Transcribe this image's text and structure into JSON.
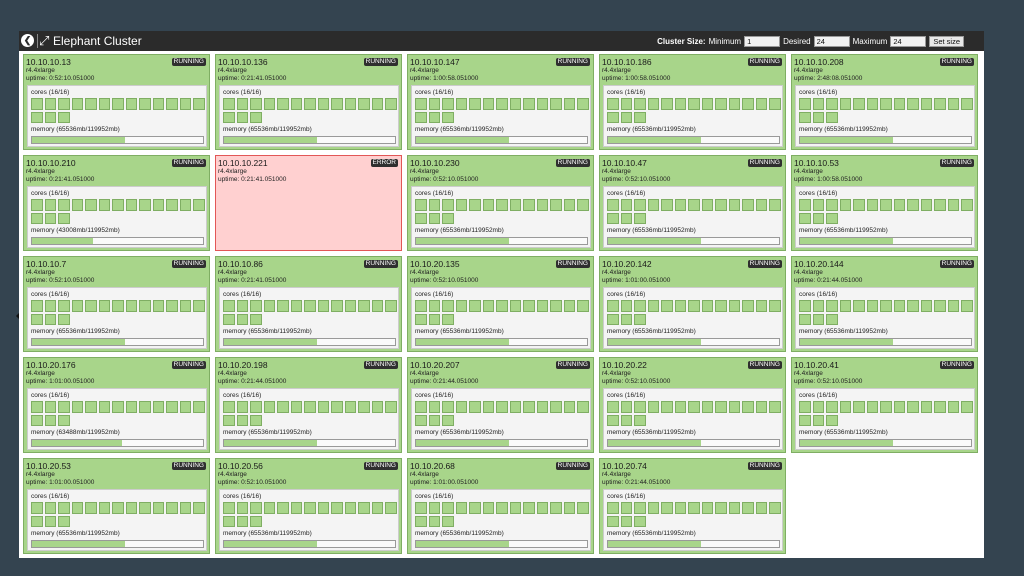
{
  "header": {
    "back_icon": "back-arrow-circle-icon",
    "expand_icon": "expand-arrows-icon",
    "title": "Elephant Cluster"
  },
  "cluster_size": {
    "label": "Cluster Size:",
    "minimum_label": "Minimum",
    "minimum_value": "1",
    "desired_label": "Desired",
    "desired_value": "24",
    "maximum_label": "Maximum",
    "maximum_value": "24",
    "set_button": "Set size"
  },
  "colors": {
    "running": "#a8d58a",
    "error": "#ffd0d0",
    "badge": "#2f2f2f"
  },
  "nodes": [
    {
      "ip": "10.10.10.13",
      "type": "r4.4xlarge",
      "uptime": "uptime: 0:52:10.051000",
      "status": "RUNNING",
      "cores_label": "cores (16/16)",
      "cores_used": 16,
      "memory_label": "memory (65536mb/119952mb)",
      "memory_fraction": 0.546
    },
    {
      "ip": "10.10.10.136",
      "type": "r4.4xlarge",
      "uptime": "uptime: 0:21:41.051000",
      "status": "RUNNING",
      "cores_label": "cores (16/16)",
      "cores_used": 16,
      "memory_label": "memory (65536mb/119952mb)",
      "memory_fraction": 0.546
    },
    {
      "ip": "10.10.10.147",
      "type": "r4.4xlarge",
      "uptime": "uptime: 1:00:58.051000",
      "status": "RUNNING",
      "cores_label": "cores (16/16)",
      "cores_used": 16,
      "memory_label": "memory (65536mb/119952mb)",
      "memory_fraction": 0.546
    },
    {
      "ip": "10.10.10.186",
      "type": "r4.4xlarge",
      "uptime": "uptime: 1:00:58.051000",
      "status": "RUNNING",
      "cores_label": "cores (16/16)",
      "cores_used": 16,
      "memory_label": "memory (65536mb/119952mb)",
      "memory_fraction": 0.546
    },
    {
      "ip": "10.10.10.208",
      "type": "r4.4xlarge",
      "uptime": "uptime: 2:48:08.051000",
      "status": "RUNNING",
      "cores_label": "cores (16/16)",
      "cores_used": 16,
      "memory_label": "memory (65536mb/119952mb)",
      "memory_fraction": 0.546
    },
    {
      "ip": "10.10.10.210",
      "type": "r4.4xlarge",
      "uptime": "uptime: 0:21:41.051000",
      "status": "RUNNING",
      "cores_label": "cores (16/16)",
      "cores_used": 16,
      "memory_label": "memory (43008mb/119952mb)",
      "memory_fraction": 0.359
    },
    {
      "ip": "10.10.10.221",
      "type": "r4.4xlarge",
      "uptime": "uptime: 0:21:41.051000",
      "status": "ERROR"
    },
    {
      "ip": "10.10.10.230",
      "type": "r4.4xlarge",
      "uptime": "uptime: 0:52:10.051000",
      "status": "RUNNING",
      "cores_label": "cores (16/16)",
      "cores_used": 16,
      "memory_label": "memory (65536mb/119952mb)",
      "memory_fraction": 0.546
    },
    {
      "ip": "10.10.10.47",
      "type": "r4.4xlarge",
      "uptime": "uptime: 0:52:10.051000",
      "status": "RUNNING",
      "cores_label": "cores (16/16)",
      "cores_used": 16,
      "memory_label": "memory (65536mb/119952mb)",
      "memory_fraction": 0.546
    },
    {
      "ip": "10.10.10.53",
      "type": "r4.4xlarge",
      "uptime": "uptime: 1:00:58.051000",
      "status": "RUNNING",
      "cores_label": "cores (16/16)",
      "cores_used": 16,
      "memory_label": "memory (65536mb/119952mb)",
      "memory_fraction": 0.546
    },
    {
      "ip": "10.10.10.7",
      "type": "r4.4xlarge",
      "uptime": "uptime: 0:52:10.051000",
      "status": "RUNNING",
      "cores_label": "cores (16/16)",
      "cores_used": 16,
      "memory_label": "memory (65536mb/119952mb)",
      "memory_fraction": 0.546
    },
    {
      "ip": "10.10.10.86",
      "type": "r4.4xlarge",
      "uptime": "uptime: 0:21:41.051000",
      "status": "RUNNING",
      "cores_label": "cores (16/16)",
      "cores_used": 16,
      "memory_label": "memory (65536mb/119952mb)",
      "memory_fraction": 0.546
    },
    {
      "ip": "10.10.20.135",
      "type": "r4.4xlarge",
      "uptime": "uptime: 0:52:10.051000",
      "status": "RUNNING",
      "cores_label": "cores (16/16)",
      "cores_used": 16,
      "memory_label": "memory (65536mb/119952mb)",
      "memory_fraction": 0.546
    },
    {
      "ip": "10.10.20.142",
      "type": "r4.4xlarge",
      "uptime": "uptime: 1:01:00.051000",
      "status": "RUNNING",
      "cores_label": "cores (16/16)",
      "cores_used": 16,
      "memory_label": "memory (65536mb/119952mb)",
      "memory_fraction": 0.546
    },
    {
      "ip": "10.10.20.144",
      "type": "r4.4xlarge",
      "uptime": "uptime: 0:21:44.051000",
      "status": "RUNNING",
      "cores_label": "cores (16/16)",
      "cores_used": 16,
      "memory_label": "memory (65536mb/119952mb)",
      "memory_fraction": 0.546
    },
    {
      "ip": "10.10.20.176",
      "type": "r4.4xlarge",
      "uptime": "uptime: 1:01:00.051000",
      "status": "RUNNING",
      "cores_label": "cores (16/16)",
      "cores_used": 16,
      "memory_label": "memory (63488mb/119952mb)",
      "memory_fraction": 0.529
    },
    {
      "ip": "10.10.20.198",
      "type": "r4.4xlarge",
      "uptime": "uptime: 0:21:44.051000",
      "status": "RUNNING",
      "cores_label": "cores (16/16)",
      "cores_used": 16,
      "memory_label": "memory (65536mb/119952mb)",
      "memory_fraction": 0.546
    },
    {
      "ip": "10.10.20.207",
      "type": "r4.4xlarge",
      "uptime": "uptime: 0:21:44.051000",
      "status": "RUNNING",
      "cores_label": "cores (16/16)",
      "cores_used": 16,
      "memory_label": "memory (65536mb/119952mb)",
      "memory_fraction": 0.546
    },
    {
      "ip": "10.10.20.22",
      "type": "r4.4xlarge",
      "uptime": "uptime: 0:52:10.051000",
      "status": "RUNNING",
      "cores_label": "cores (16/16)",
      "cores_used": 16,
      "memory_label": "memory (65536mb/119952mb)",
      "memory_fraction": 0.546
    },
    {
      "ip": "10.10.20.41",
      "type": "r4.4xlarge",
      "uptime": "uptime: 0:52:10.051000",
      "status": "RUNNING",
      "cores_label": "cores (16/16)",
      "cores_used": 16,
      "memory_label": "memory (65536mb/119952mb)",
      "memory_fraction": 0.546
    },
    {
      "ip": "10.10.20.53",
      "type": "r4.4xlarge",
      "uptime": "uptime: 1:01:00.051000",
      "status": "RUNNING",
      "cores_label": "cores (16/16)",
      "cores_used": 16,
      "memory_label": "memory (65536mb/119952mb)",
      "memory_fraction": 0.546
    },
    {
      "ip": "10.10.20.56",
      "type": "r4.4xlarge",
      "uptime": "uptime: 0:52:10.051000",
      "status": "RUNNING",
      "cores_label": "cores (16/16)",
      "cores_used": 16,
      "memory_label": "memory (65536mb/119952mb)",
      "memory_fraction": 0.546
    },
    {
      "ip": "10.10.20.68",
      "type": "r4.4xlarge",
      "uptime": "uptime: 1:01:00.051000",
      "status": "RUNNING",
      "cores_label": "cores (16/16)",
      "cores_used": 16,
      "memory_label": "memory (65536mb/119952mb)",
      "memory_fraction": 0.546
    },
    {
      "ip": "10.10.20.74",
      "type": "r4.4xlarge",
      "uptime": "uptime: 0:21:44.051000",
      "status": "RUNNING",
      "cores_label": "cores (16/16)",
      "cores_used": 16,
      "memory_label": "memory (65536mb/119952mb)",
      "memory_fraction": 0.546
    }
  ]
}
